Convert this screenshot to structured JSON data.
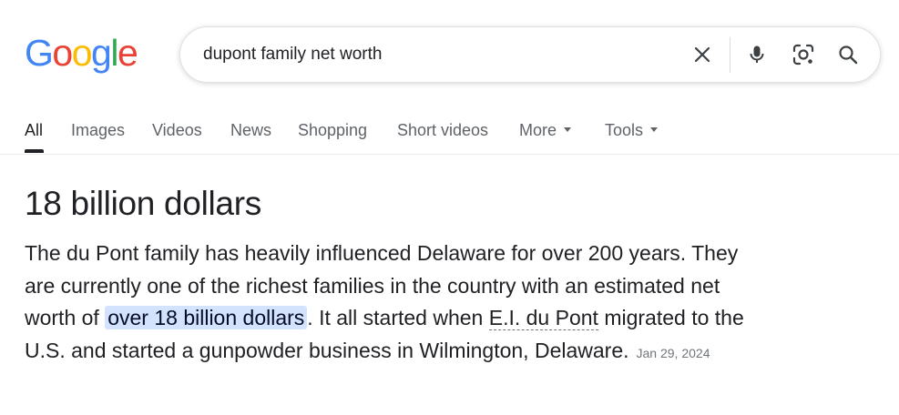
{
  "logo": {
    "letters": [
      "G",
      "o",
      "o",
      "g",
      "l",
      "e"
    ],
    "colors": [
      "#4285F4",
      "#EA4335",
      "#FBBC05",
      "#4285F4",
      "#34A853",
      "#EA4335"
    ]
  },
  "search": {
    "query": "dupont family net worth"
  },
  "tabs": [
    {
      "label": "All",
      "active": true
    },
    {
      "label": "Images"
    },
    {
      "label": "Videos"
    },
    {
      "label": "News"
    },
    {
      "label": "Shopping"
    },
    {
      "label": "Short videos"
    },
    {
      "label": "More",
      "dropdown": true
    },
    {
      "label": "Tools",
      "dropdown": true
    }
  ],
  "answer": {
    "title": "18 billion dollars",
    "text_before": "The du Pont family has heavily influenced Delaware for over 200 years. They are currently one of the richest families in the country with an estimated net worth of ",
    "highlight": "over 18 billion dollars",
    "text_middle": ". It all started when ",
    "linked_term": "E.I. du Pont",
    "text_after": " migrated to the U.S. and started a gunpowder business in Wilmington, Delaware.",
    "date": "Jan 29, 2024"
  },
  "icons": {
    "clear": "close-icon",
    "voice": "mic-icon",
    "lens": "lens-icon",
    "search": "search-icon"
  },
  "colors": {
    "highlight_bg": "#d3e3fd",
    "google_blue": "#4285F4",
    "mic_red": "#EA4335",
    "mic_yellow": "#FBBC05",
    "mic_green": "#34A853"
  }
}
